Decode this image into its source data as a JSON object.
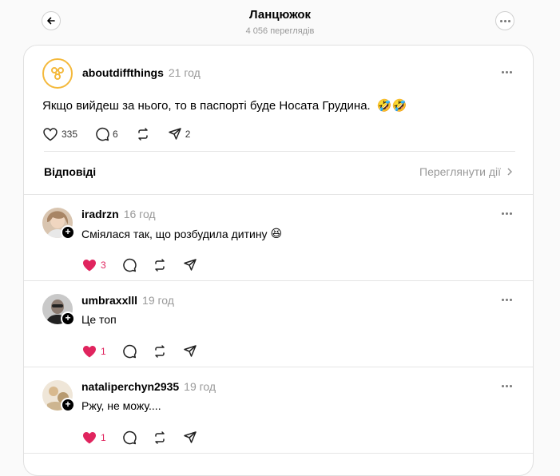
{
  "header": {
    "title": "Ланцюжок",
    "views": "4 056 переглядів"
  },
  "post": {
    "username": "aboutdiffthings",
    "time": "21 год",
    "text": "Якщо вийдеш за нього, то в паспорті буде Носата Грудина.",
    "emoji": "🤣🤣",
    "likes": "335",
    "comments": "6",
    "shares": "2"
  },
  "replies_section": {
    "label": "Відповіді",
    "view_activity": "Переглянути дії"
  },
  "replies": [
    {
      "username": "iradrzn",
      "time": "16 год",
      "text": "Сміялася так, що розбудила дитину",
      "emoji": "😆",
      "likes": "3"
    },
    {
      "username": "umbraxxlll",
      "time": "19 год",
      "text": "Це топ",
      "emoji": "",
      "likes": "1"
    },
    {
      "username": "nataliperchyn2935",
      "time": "19 год",
      "text": "Ржу, не можу....",
      "emoji": "",
      "likes": "1"
    }
  ],
  "colors": {
    "like": "#e0245e",
    "accent_ring": "#f4b93c"
  },
  "icons": [
    "back-arrow-icon",
    "more-icon",
    "heart-icon",
    "comment-icon",
    "repost-icon",
    "share-icon",
    "chevron-right-icon",
    "plus-icon"
  ]
}
